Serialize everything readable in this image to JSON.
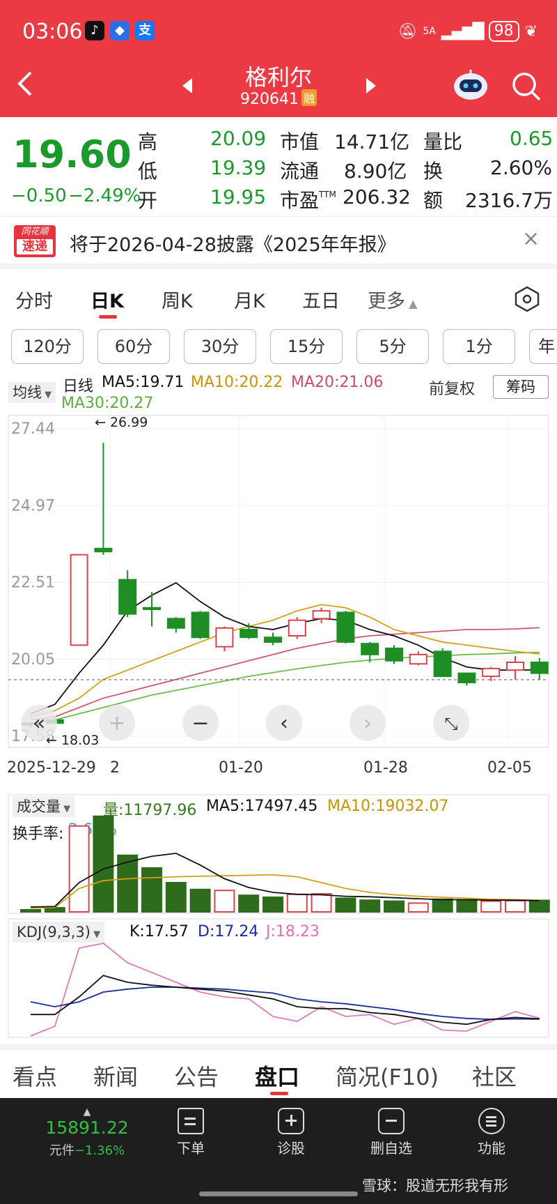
{
  "status_bar": {
    "time": "03:06",
    "signal": "5A",
    "battery": "98"
  },
  "header": {
    "title": "格利尔",
    "code": "920641",
    "badge": "融"
  },
  "quote": {
    "price": "19.60",
    "change": "−0.50",
    "change_pct": "−2.49%",
    "rows": [
      {
        "l1": "高",
        "v1": "20.09",
        "l2": "市值",
        "v2": "14.71亿",
        "l3": "量比",
        "v3": "0.65"
      },
      {
        "l1": "低",
        "v1": "19.39",
        "l2": "流通",
        "v2": "8.90亿",
        "l3": "换",
        "v3": "2.60%"
      },
      {
        "l1": "开",
        "v1": "19.95",
        "l2": "市盈",
        "l2sup": "TTM",
        "v2": "206.32",
        "l3": "额",
        "v3": "2316.7万"
      }
    ]
  },
  "notice": {
    "logo_top": "同花顺",
    "logo_bottom": "速递",
    "text": "将于2026-04-28披露《2025年年报》",
    "close": "×"
  },
  "period_tabs": [
    "分时",
    "日K",
    "周K",
    "月K",
    "五日",
    "更多"
  ],
  "active_period": "日K",
  "interval_buttons": [
    "120分",
    "60分",
    "30分",
    "15分",
    "5分",
    "1分",
    "年"
  ],
  "chart_header": {
    "indicator_select": "均线",
    "daily_label": "日线",
    "ma5": "MA5:19.71",
    "ma10": "MA10:20.22",
    "ma20": "MA20:21.06",
    "ma30": "MA30:20.27",
    "adjust": "前复权",
    "chips_button": "筹码"
  },
  "colors": {
    "header_red": "#eb3a43",
    "up_red": "#d9434b",
    "down_green": "#1f8f25",
    "ma5": "#111111",
    "ma10": "#d4a017",
    "ma20": "#d0566f",
    "ma30": "#6cbc4c"
  },
  "chart_data": [
    {
      "type": "candlestick",
      "title": "日线",
      "y_ticks": [
        "27.44",
        "24.97",
        "22.51",
        "20.05",
        "17.58"
      ],
      "x_ticks": [
        "2025-12-29",
        "2",
        "01-20",
        "01-28",
        "02-05"
      ],
      "annotations": [
        "← 26.99",
        "← 18.03"
      ],
      "ylim": [
        17.58,
        27.44
      ],
      "candles": [
        {
          "o": 18.0,
          "c": 17.95,
          "h": 18.03,
          "l": 17.85
        },
        {
          "o": 18.1,
          "c": 18.0,
          "h": 18.2,
          "l": 18.03
        },
        {
          "o": 20.5,
          "c": 23.4,
          "h": 23.4,
          "l": 20.5
        },
        {
          "o": 23.6,
          "c": 23.5,
          "h": 26.99,
          "l": 23.4
        },
        {
          "o": 22.6,
          "c": 21.5,
          "h": 22.9,
          "l": 21.4
        },
        {
          "o": 21.7,
          "c": 21.65,
          "h": 22.2,
          "l": 21.1
        },
        {
          "o": 21.35,
          "c": 21.05,
          "h": 21.4,
          "l": 20.9
        },
        {
          "o": 21.55,
          "c": 20.75,
          "h": 21.6,
          "l": 20.7
        },
        {
          "o": 20.45,
          "c": 21.05,
          "h": 21.1,
          "l": 20.3
        },
        {
          "o": 21.0,
          "c": 20.75,
          "h": 21.2,
          "l": 20.7
        },
        {
          "o": 20.75,
          "c": 20.6,
          "h": 20.9,
          "l": 20.5
        },
        {
          "o": 20.8,
          "c": 21.3,
          "h": 21.4,
          "l": 20.7
        },
        {
          "o": 21.35,
          "c": 21.6,
          "h": 21.7,
          "l": 21.2
        },
        {
          "o": 21.55,
          "c": 20.6,
          "h": 21.6,
          "l": 20.55
        },
        {
          "o": 20.55,
          "c": 20.2,
          "h": 20.6,
          "l": 19.95
        },
        {
          "o": 20.4,
          "c": 20.0,
          "h": 20.5,
          "l": 19.9
        },
        {
          "o": 19.9,
          "c": 20.2,
          "h": 20.3,
          "l": 19.85
        },
        {
          "o": 20.3,
          "c": 19.5,
          "h": 20.4,
          "l": 19.5
        },
        {
          "o": 19.6,
          "c": 19.3,
          "h": 19.6,
          "l": 19.2
        },
        {
          "o": 19.5,
          "c": 19.75,
          "h": 19.8,
          "l": 19.35
        },
        {
          "o": 19.7,
          "c": 19.95,
          "h": 20.15,
          "l": 19.4
        },
        {
          "o": 19.95,
          "c": 19.6,
          "h": 20.09,
          "l": 19.39
        }
      ],
      "ma5": [
        18.3,
        18.6,
        19.6,
        20.5,
        21.6,
        22.1,
        22.5,
        21.9,
        21.4,
        21.1,
        21.0,
        21.2,
        21.35,
        21.3,
        21.0,
        20.8,
        20.5,
        20.1,
        19.8,
        19.7,
        19.7,
        19.71
      ],
      "ma10": [
        18.2,
        18.4,
        18.8,
        19.4,
        19.7,
        20.0,
        20.3,
        20.6,
        20.9,
        21.1,
        21.3,
        21.6,
        21.8,
        21.7,
        21.4,
        21.0,
        20.8,
        20.6,
        20.5,
        20.4,
        20.3,
        20.22
      ],
      "ma20": [
        18.1,
        18.2,
        18.5,
        18.8,
        19.0,
        19.2,
        19.4,
        19.6,
        19.8,
        20.0,
        20.2,
        20.4,
        20.55,
        20.7,
        20.8,
        20.85,
        20.9,
        20.95,
        21.0,
        21.0,
        21.02,
        21.06
      ],
      "ma30": [
        18.0,
        18.1,
        18.3,
        18.5,
        18.7,
        18.9,
        19.05,
        19.2,
        19.35,
        19.5,
        19.62,
        19.74,
        19.85,
        19.95,
        20.02,
        20.08,
        20.12,
        20.16,
        20.2,
        20.22,
        20.25,
        20.27
      ]
    },
    {
      "type": "bar",
      "title": "成交量",
      "legend": {
        "vol": "量:11797.96",
        "ma5": "MA5:17497.45",
        "ma10": "MA10:19032.07",
        "sub_label": "换手率:",
        "sub_value": "2.60%"
      },
      "values": [
        2200,
        4200,
        88000,
        98000,
        58000,
        45000,
        30000,
        23000,
        22000,
        17000,
        15000,
        18000,
        18500,
        14000,
        12000,
        11000,
        9000,
        13000,
        12500,
        11000,
        11500,
        11798
      ],
      "ma5": [
        5000,
        5500,
        30000,
        44000,
        51000,
        57000,
        60000,
        48000,
        34000,
        25000,
        20000,
        18000,
        17500,
        16000,
        15500,
        14500,
        13500,
        12500,
        12500,
        12000,
        12000,
        11500
      ],
      "ma10": [
        4000,
        4500,
        24000,
        32000,
        34000,
        35000,
        36000,
        36500,
        37000,
        37500,
        38000,
        36000,
        30000,
        24000,
        20000,
        17500,
        16000,
        15000,
        14000,
        13000,
        12500,
        12000
      ]
    },
    {
      "type": "line",
      "title": "KDJ(9,3,3)",
      "legend": {
        "k": "K:17.57",
        "d": "D:17.24",
        "j": "J:18.23"
      },
      "k": [
        22,
        22,
        40,
        62,
        55,
        52,
        50,
        48,
        46,
        42,
        38,
        30,
        28,
        28,
        24,
        22,
        18,
        14,
        12,
        17,
        19,
        17.57
      ],
      "d": [
        35,
        30,
        35,
        45,
        48,
        50,
        50,
        49,
        48,
        46,
        44,
        38,
        35,
        33,
        30,
        27,
        23,
        20,
        18,
        17,
        17.5,
        17.24
      ],
      "j": [
        0,
        10,
        90,
        95,
        75,
        65,
        55,
        45,
        40,
        38,
        20,
        15,
        30,
        20,
        22,
        12,
        18,
        6,
        5,
        15,
        25,
        18.23
      ]
    }
  ],
  "chart_controls": [
    "«",
    "+",
    "−",
    "‹",
    "›",
    "⤡"
  ],
  "bottom_tabs": [
    "看点",
    "新闻",
    "公告",
    "盘口",
    "简况(F10)",
    "社区"
  ],
  "active_bottom_tab": "盘口",
  "footer": {
    "index_value": "15891.22",
    "index_label": "元件",
    "index_change": "−1.36%",
    "buttons": [
      "下单",
      "诊股",
      "删自选",
      "功能"
    ],
    "watermark": "雪球：股道无形我有形"
  }
}
